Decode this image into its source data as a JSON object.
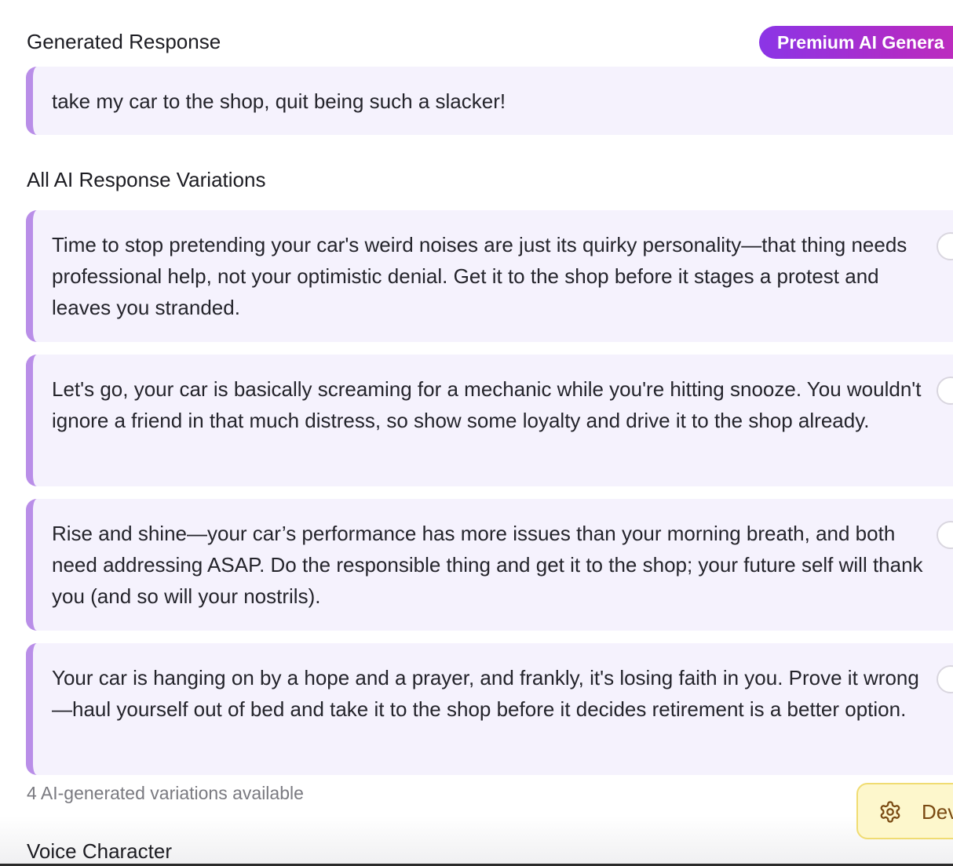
{
  "header": {
    "title": "Generated Response",
    "badge": "Premium AI Genera"
  },
  "generated_response": {
    "text": "take my car to the shop, quit being such a slacker!"
  },
  "variations": {
    "title": "All AI Response Variations",
    "items": [
      {
        "text": "Time to stop pretending your car's weird noises are just its quirky personality—that thing needs professional help, not your optimistic denial. Get it to the shop before it stages a protest and leaves you stranded."
      },
      {
        "text": "Let's go, your car is basically screaming for a mechanic while you're hitting snooze. You wouldn't ignore a friend in that much distress, so show some loyalty and drive it to the shop already."
      },
      {
        "text": "Rise and shine—your car’s performance has more issues than your morning breath, and both need addressing ASAP. Do the responsible thing and get it to the shop; your future self will thank you (and so will your nostrils)."
      },
      {
        "text": "Your car is hanging on by a hope and a prayer, and frankly, it's losing faith in you. Prove it wrong—haul yourself out of bed and take it to the shop before it decides retirement is a better option."
      }
    ],
    "count_note": "4 AI-generated variations available"
  },
  "dev_button": {
    "label": "Dev",
    "icon": "gear-icon"
  },
  "voice_character": {
    "title": "Voice Character"
  },
  "colors": {
    "accent_border": "#b98ee8",
    "card_background": "#f5f2fd",
    "badge_gradient_start": "#8b35e6",
    "badge_gradient_end": "#c52bb8",
    "dev_button_background": "#fdf7cc"
  }
}
